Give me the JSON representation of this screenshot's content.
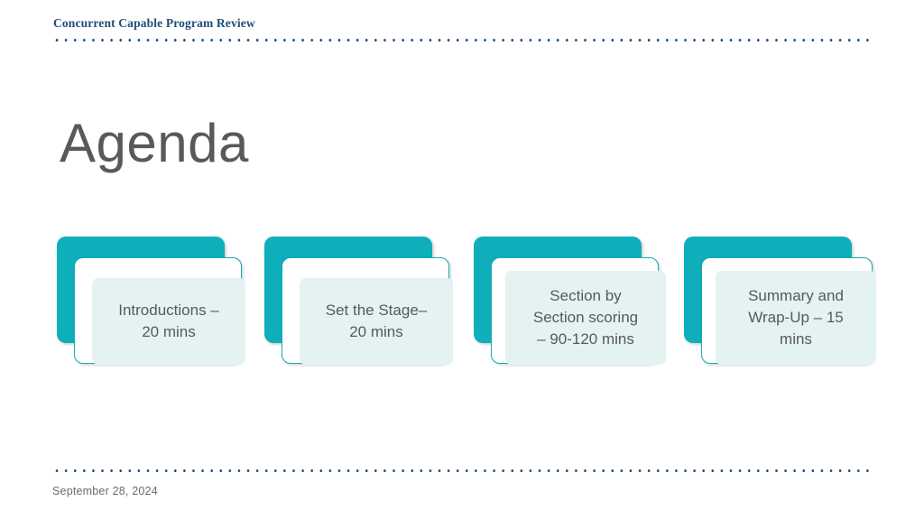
{
  "slide": {
    "header_title": "Concurrent Capable Program Review",
    "page_title": "Agenda",
    "footer_date": "September 28, 2024",
    "colors": {
      "accent_teal": "#0FAEBB",
      "card_border": "#17ABB8",
      "panel_fill": "#E4F2F2",
      "header_blue": "#1F4E79",
      "text_gray": "#595959",
      "background": "#FFFFFF"
    }
  },
  "agenda": {
    "cards": [
      {
        "label": "Introductions –\n20 mins"
      },
      {
        "label": "Set the Stage–\n20 mins"
      },
      {
        "label": "Section by\nSection scoring\n– 90-120 mins"
      },
      {
        "label": "Summary and\nWrap-Up – 15\nmins"
      }
    ]
  }
}
